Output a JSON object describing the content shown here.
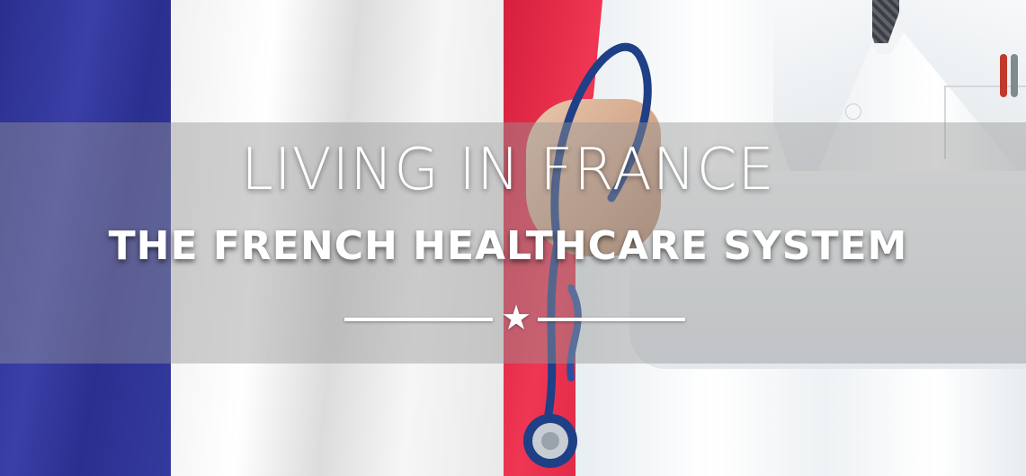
{
  "banner": {
    "title": "LIVING IN FRANCE",
    "subtitle": "THE FRENCH HEALTHCARE SYSTEM",
    "divider_icon": "star-icon"
  },
  "colors": {
    "flag_blue": "#2f349a",
    "flag_white": "#f4f4f4",
    "flag_red": "#e52d48",
    "text": "#ffffff",
    "band": "#969696"
  }
}
